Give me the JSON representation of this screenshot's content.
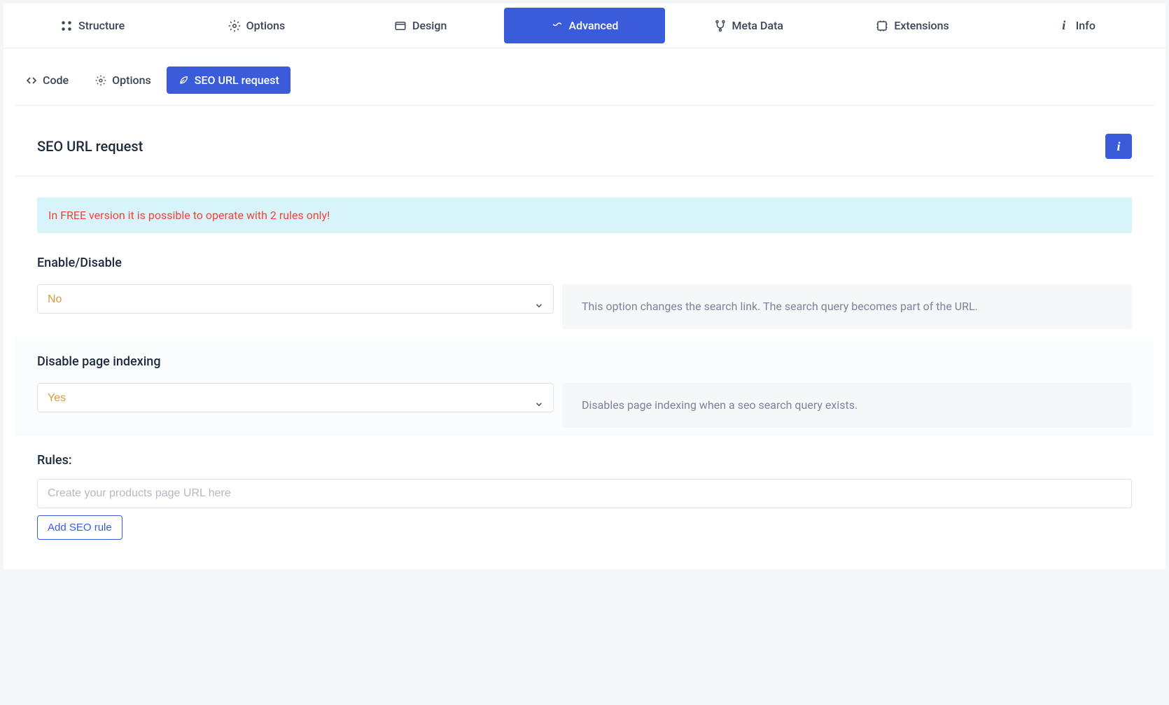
{
  "main_tabs": [
    {
      "label": "Structure"
    },
    {
      "label": "Options"
    },
    {
      "label": "Design"
    },
    {
      "label": "Advanced"
    },
    {
      "label": "Meta Data"
    },
    {
      "label": "Extensions"
    },
    {
      "label": "Info"
    }
  ],
  "sub_tabs": [
    {
      "label": "Code"
    },
    {
      "label": "Options"
    },
    {
      "label": "SEO URL request"
    }
  ],
  "section_title": "SEO URL request",
  "notice_text": "In FREE version it is possible to operate with 2 rules only!",
  "enable_disable": {
    "label": "Enable/Disable",
    "value": "No",
    "help": "This option changes the search link. The search query becomes part of the URL."
  },
  "disable_indexing": {
    "label": "Disable page indexing",
    "value": "Yes",
    "help": "Disables page indexing when a seo search query exists."
  },
  "rules": {
    "label": "Rules:",
    "placeholder": "Create your products page URL here",
    "button": "Add SEO rule"
  }
}
